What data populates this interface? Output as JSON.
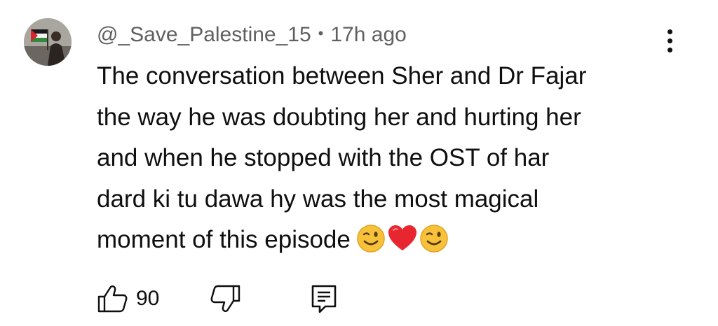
{
  "comment": {
    "author": "@_Save_Palestine_15",
    "separator": "•",
    "timestamp": "17h ago",
    "text_lines": [
      "The conversation between Sher and Dr Fajar",
      "the way he was doubting her and hurting her",
      "and when he stopped with the OST of har",
      "dard ki tu dawa hy was the most magical",
      "moment of this episode"
    ],
    "emojis": [
      "winking-face",
      "red-heart",
      "winking-face"
    ]
  },
  "actions": {
    "like_count": "90",
    "like_icon": "thumbs-up-icon",
    "dislike_icon": "thumbs-down-icon",
    "reply_icon": "reply-comment-icon",
    "more_icon": "more-vertical-icon"
  },
  "colors": {
    "text": "#0f0f0f",
    "meta": "#606060",
    "emoji_face": "#f7c23a",
    "heart": "#e8262f"
  }
}
